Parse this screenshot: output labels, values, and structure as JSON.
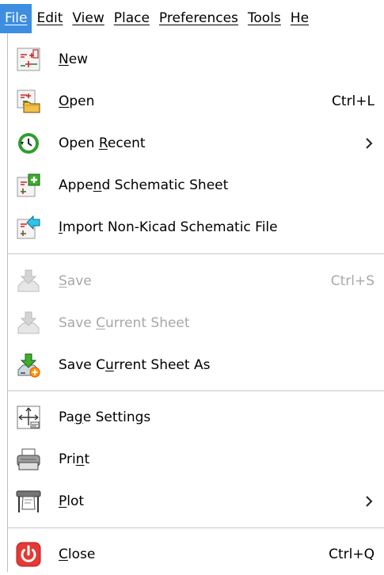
{
  "menubar": {
    "items": [
      "File",
      "Edit",
      "View",
      "Place",
      "Preferences",
      "Tools",
      "He"
    ]
  },
  "file_menu": {
    "new": {
      "label_pre": "",
      "label_key": "N",
      "label_post": "ew",
      "icon": "new-schematic-icon"
    },
    "open": {
      "label_pre": "",
      "label_key": "O",
      "label_post": "pen",
      "shortcut": "Ctrl+L",
      "icon": "open-folder-icon"
    },
    "open_recent": {
      "label_pre": "Open ",
      "label_key": "R",
      "label_post": "ecent",
      "icon": "recent-clock-icon"
    },
    "append": {
      "label_pre": "Appe",
      "label_key": "n",
      "label_post": "d Schematic Sheet",
      "icon": "append-sheet-icon"
    },
    "import": {
      "label_pre": "",
      "label_key": "I",
      "label_post": "mport Non-Kicad Schematic File",
      "icon": "import-icon"
    },
    "save": {
      "label_pre": "",
      "label_key": "S",
      "label_post": "ave",
      "shortcut": "Ctrl+S",
      "icon": "save-icon"
    },
    "save_current": {
      "label_pre": "Save ",
      "label_key": "C",
      "label_post": "urrent Sheet",
      "icon": "save-sheet-icon"
    },
    "save_as": {
      "label_pre": "Save C",
      "label_key": "u",
      "label_post": "rrent Sheet As",
      "icon": "save-as-icon"
    },
    "page_settings": {
      "label_pre": "Pa",
      "label_key": "g",
      "label_post": "e Settings",
      "icon": "page-settings-icon"
    },
    "print": {
      "label_pre": "Pri",
      "label_key": "n",
      "label_post": "t",
      "icon": "printer-icon"
    },
    "plot": {
      "label_pre": "",
      "label_key": "P",
      "label_post": "lot",
      "icon": "plotter-icon"
    },
    "close": {
      "label_pre": "",
      "label_key": "C",
      "label_post": "lose",
      "shortcut": "Ctrl+Q",
      "icon": "power-icon"
    }
  },
  "colors": {
    "menubar_active_bg": "#3d8ee0",
    "disabled_text": "#a8a8a8",
    "close_icon_red": "#e53935",
    "recent_icon_green": "#2e9e2e"
  }
}
